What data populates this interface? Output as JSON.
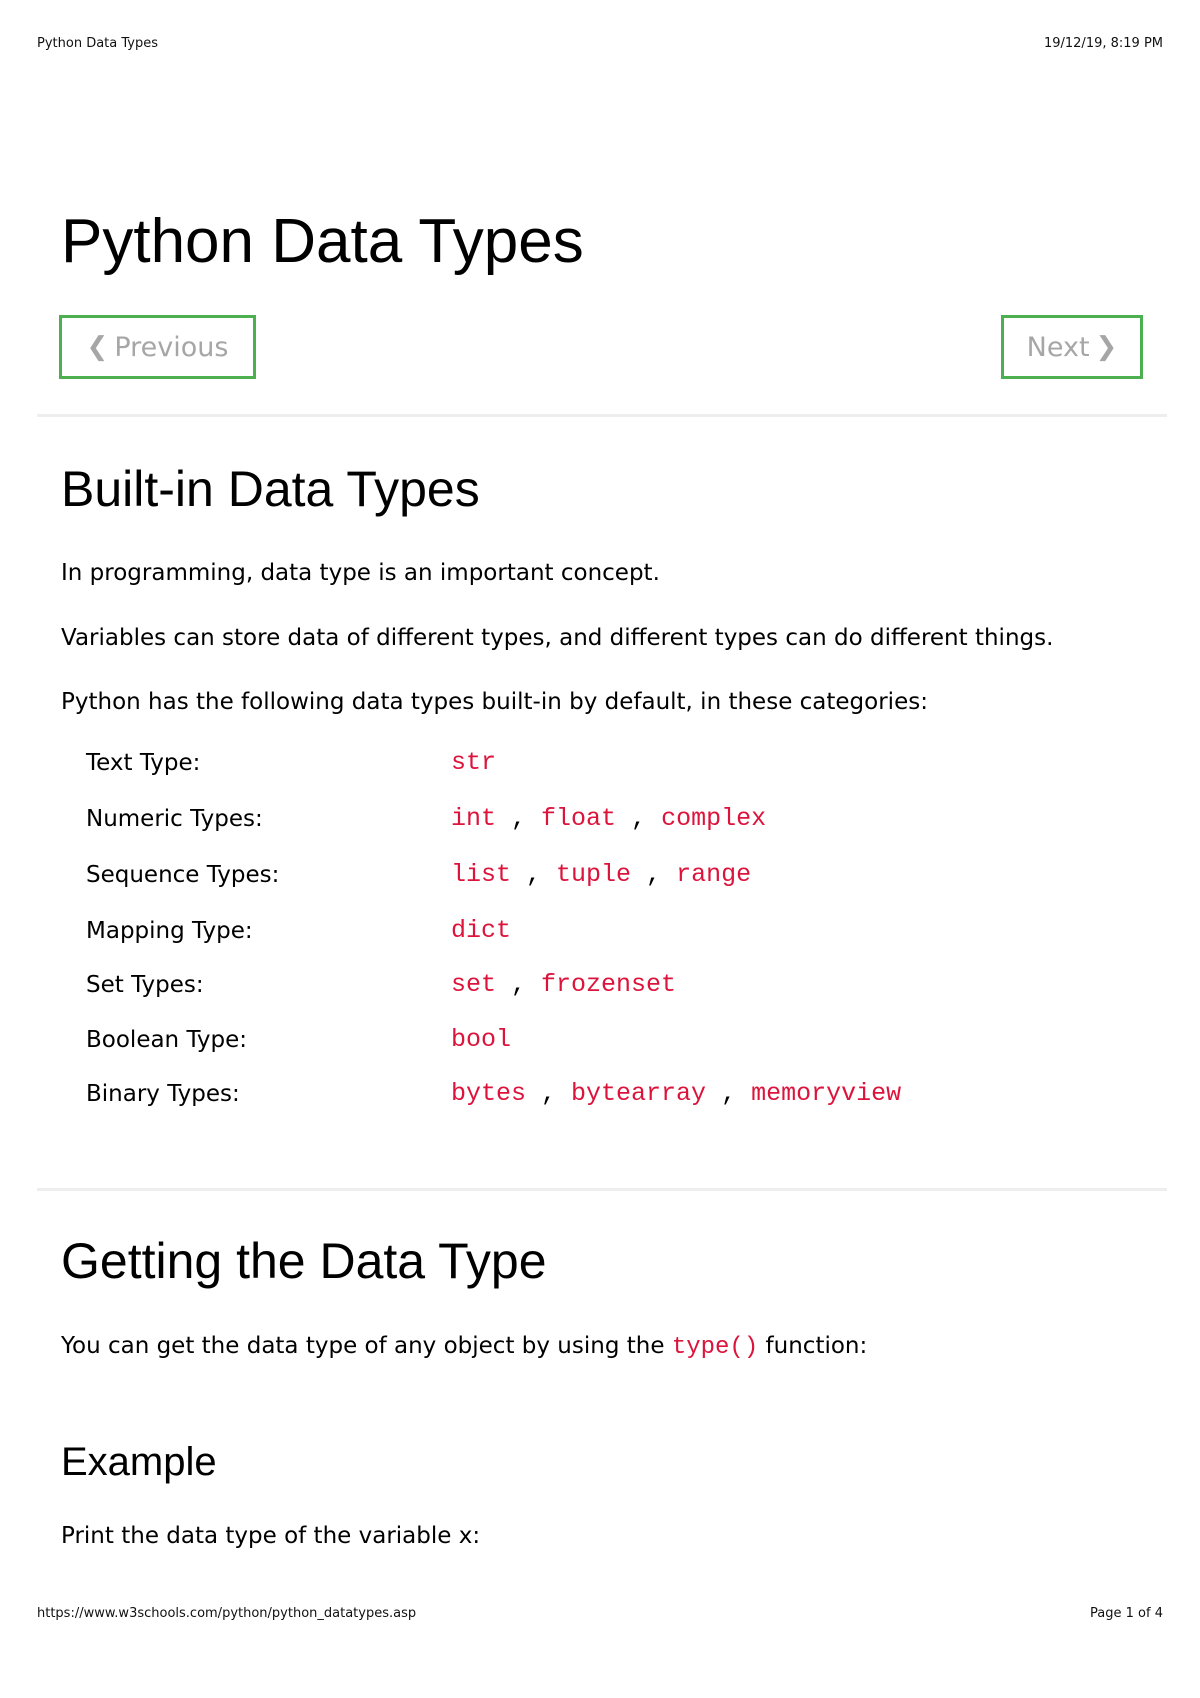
{
  "print_header": {
    "title": "Python Data Types",
    "datetime": "19/12/19, 8:19 PM"
  },
  "print_footer": {
    "url": "https://www.w3schools.com/python/python_datatypes.asp",
    "page": "Page 1 of 4"
  },
  "page_title": "Python Data Types",
  "nav": {
    "previous_label": "Previous",
    "next_label": "Next",
    "previous_icon": "chevron-left-icon",
    "next_icon": "chevron-right-icon",
    "border_color": "#4CAF50"
  },
  "builtin": {
    "heading": "Built-in Data Types",
    "paragraphs": [
      "In programming, data type is an important concept.",
      "Variables can store data of different types, and different types can do different things.",
      "Python has the following data types built-in by default, in these categories:"
    ],
    "table": [
      {
        "label": "Text Type:",
        "values": [
          "str"
        ]
      },
      {
        "label": "Numeric Types:",
        "values": [
          "int",
          "float",
          "complex"
        ]
      },
      {
        "label": "Sequence Types:",
        "values": [
          "list",
          "tuple",
          "range"
        ]
      },
      {
        "label": "Mapping Type:",
        "values": [
          "dict"
        ]
      },
      {
        "label": "Set Types:",
        "values": [
          "set",
          "frozenset"
        ]
      },
      {
        "label": "Boolean Type:",
        "values": [
          "bool"
        ]
      },
      {
        "label": "Binary Types:",
        "values": [
          "bytes",
          "bytearray",
          "memoryview"
        ]
      }
    ]
  },
  "getting": {
    "heading": "Getting the Data Type",
    "text_before": "You can get the data type of any object by using the",
    "code": "type()",
    "text_after": "function:"
  },
  "example": {
    "heading": "Example",
    "text": "Print the data type of the variable x:"
  },
  "colors": {
    "code": "#dc143c",
    "accent": "#4CAF50"
  }
}
